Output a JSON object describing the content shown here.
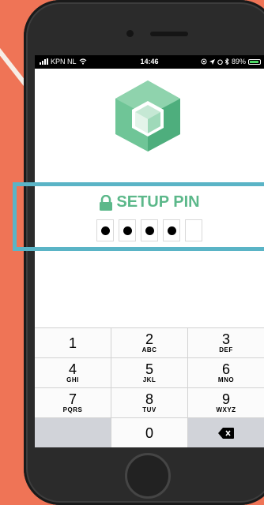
{
  "status": {
    "carrier": "KPN NL",
    "time": "14:46",
    "battery": "89%"
  },
  "app": {
    "title": "SETUP PIN",
    "accent": "#5cb88a",
    "pin_total": 5,
    "pin_filled": 4
  },
  "keypad": [
    {
      "digit": "1",
      "letters": ""
    },
    {
      "digit": "2",
      "letters": "ABC"
    },
    {
      "digit": "3",
      "letters": "DEF"
    },
    {
      "digit": "4",
      "letters": "GHI"
    },
    {
      "digit": "5",
      "letters": "JKL"
    },
    {
      "digit": "6",
      "letters": "MNO"
    },
    {
      "digit": "7",
      "letters": "PQRS"
    },
    {
      "digit": "8",
      "letters": "TUV"
    },
    {
      "digit": "9",
      "letters": "WXYZ"
    },
    {
      "digit": "",
      "letters": ""
    },
    {
      "digit": "0",
      "letters": ""
    },
    {
      "digit": "delete-icon",
      "letters": ""
    }
  ],
  "colors": {
    "background": "#ef7456",
    "highlight_frame": "#5ab4c6"
  }
}
